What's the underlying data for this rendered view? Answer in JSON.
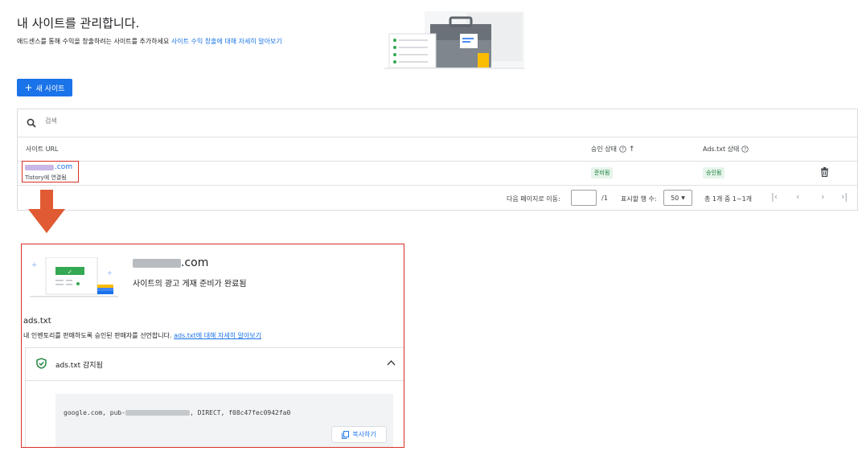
{
  "header": {
    "title": "내 사이트를 관리합니다.",
    "subtitle": "애드센스를 통해 수익을 창출하려는 사이트를 추가하세요",
    "subtitle_link": "사이트 수익 창출에 대해 자세히 알아보기"
  },
  "new_site_button": "새 사이트",
  "search": {
    "placeholder": "검색"
  },
  "table": {
    "columns": {
      "url": "사이트 URL",
      "approval": "승인 상태",
      "adstxt": "Ads.txt 상태"
    },
    "row": {
      "url_suffix": ".com",
      "connected": "Tistory에 연결됨",
      "approval_status": "준비됨",
      "adstxt_status": "승인됨"
    }
  },
  "pagination": {
    "goto_label": "다음 페이지로 이동:",
    "page_total": "/1",
    "rows_label": "표시할 행 수:",
    "rows_value": "50",
    "range": "총 1개 중 1~1개"
  },
  "detail": {
    "domain_suffix": ".com",
    "status": "사이트의 광고 게재 준비가 완료됨",
    "section_title": "ads.txt",
    "section_desc": "내 인벤토리를 판매하도록 승인된 판매자를 선언합니다.",
    "section_link": "ads.txt에 대해 자세히 알아보기",
    "detected": "ads.txt 감지됨",
    "code_prefix": "google.com, pub-",
    "code_suffix": ", DIRECT, f08c47fec0942fa0",
    "copy_button": "복사하기"
  },
  "colors": {
    "accent": "#1a73e8",
    "highlight": "#d93025",
    "arrow": "#e05a33",
    "success": "#188038"
  },
  "icons": [
    "plus-icon",
    "search-icon",
    "help-icon",
    "sort-up-icon",
    "delete-icon",
    "first-page-icon",
    "prev-page-icon",
    "next-page-icon",
    "last-page-icon",
    "down-arrow-icon",
    "check-shield-icon",
    "chevron-up-icon",
    "copy-icon"
  ]
}
